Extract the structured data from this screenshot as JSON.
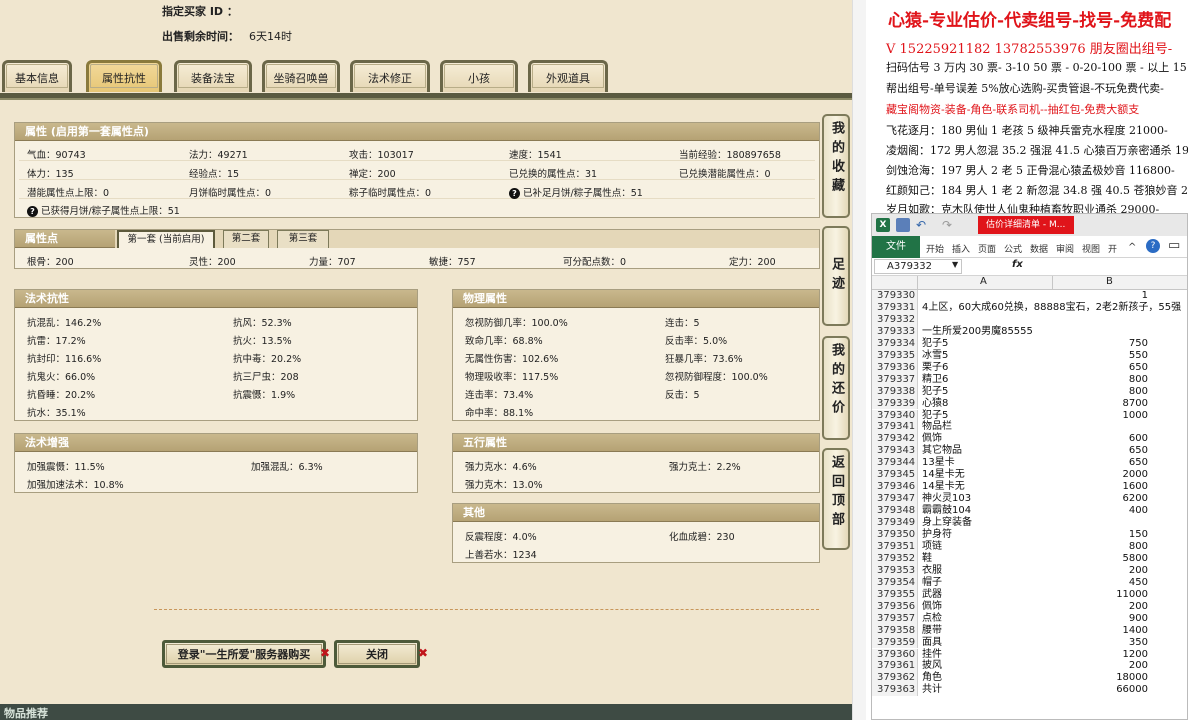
{
  "header": {
    "buyer_label": "指定买家 ID ：",
    "buyer_value": "",
    "time_label": "出售剩余时间：",
    "time_value": "6天14时"
  },
  "tabs": [
    "基本信息",
    "属性抗性",
    "装备法宝",
    "坐骑召唤兽",
    "法术修正",
    "小孩",
    "外观道具"
  ],
  "active_tab": "属性抗性",
  "attr_panel": {
    "title": "属性 (启用第一套属性点)",
    "rows": [
      [
        "气血：90743",
        "法力：49271",
        "攻击：103017",
        "速度：1541",
        "当前经验：180897658"
      ],
      [
        "体力：135",
        "经验点：15",
        "禅定：200",
        "已兑换的属性点：31",
        "已兑换潜能属性点：0"
      ],
      [
        "潜能属性点上限：0",
        "月饼临时属性点：0",
        "粽子临时属性点：0",
        "已补足月饼/粽子属性点：51",
        ""
      ],
      [
        "已获得月饼/粽子属性点上限：51",
        "",
        "",
        "",
        ""
      ]
    ]
  },
  "points_panel": {
    "title": "属性点",
    "subtabs": [
      "第一套 (当前启用)",
      "第二套",
      "第三套"
    ],
    "values": [
      "根骨：200",
      "灵性：200",
      "力量：707",
      "敏捷：757",
      "可分配点数：0",
      "定力：200"
    ]
  },
  "spell_resist": {
    "title": "法术抗性",
    "rows": [
      [
        "抗混乱：146.2%",
        "抗风：52.3%"
      ],
      [
        "抗雷：17.2%",
        "抗火：13.5%"
      ],
      [
        "抗封印：116.6%",
        "抗中毒：20.2%"
      ],
      [
        "抗鬼火：66.0%",
        "抗三尸虫：208"
      ],
      [
        "抗昏睡：20.2%",
        "抗震慑：1.9%"
      ],
      [
        "抗水：35.1%",
        ""
      ]
    ]
  },
  "physical": {
    "title": "物理属性",
    "rows": [
      [
        "忽视防御几率：100.0%",
        "连击：5"
      ],
      [
        "致命几率：68.8%",
        "反击率：5.0%"
      ],
      [
        "无属性伤害：102.6%",
        "狂暴几率：73.6%"
      ],
      [
        "物理吸收率：117.5%",
        "忽视防御程度：100.0%"
      ],
      [
        "连击率：73.4%",
        "反击：5"
      ],
      [
        "命中率：88.1%",
        ""
      ]
    ]
  },
  "spell_boost": {
    "title": "法术增强",
    "rows": [
      [
        "加强震慑：11.5%",
        "加强混乱：6.3%"
      ],
      [
        "加强加速法术：10.8%",
        ""
      ]
    ]
  },
  "five_elements": {
    "title": "五行属性",
    "rows": [
      [
        "强力克水：4.6%",
        "强力克土：2.2%"
      ],
      [
        "强力克木：13.0%",
        ""
      ]
    ]
  },
  "other": {
    "title": "其他",
    "rows": [
      [
        "反震程度：4.0%",
        "化血成碧：230"
      ],
      [
        "上善若水：1234",
        ""
      ]
    ]
  },
  "side_buttons": [
    "我的收藏",
    "足迹",
    "我的还价",
    "返回顶部"
  ],
  "buttons": {
    "login": "登录\"一生所爱\"服务器购买",
    "close": "关闭"
  },
  "footer": "物品推荐",
  "ad": {
    "title": "心猿-专业估价-代卖组号-找号-免费配",
    "phone": "V 15225921182    13782553976 朋友圈出组号-",
    "lines": [
      "扫码估号 3 万内 30 票- 3-10 50 票 - 0-20-100 票 - 以上 15",
      "帮出组号-单号误差 5%放心选购-买贵管退-不玩免费代卖-",
      "藏宝阁物资-装备-角色-联系司机--抽红包-免费大额支",
      "飞花逐月：180 男仙 1 老孩 5 级神兵雷克水程度 21000-",
      "凌烟阁：172 男人忽混 35.2 强混 41.5 心猿百万亲密通杀 193",
      "剑蚀沧海：197 男人 2 老 5 正骨混心猿孟极妙音 116800-",
      "红颜知己：184 男人 1 老 2 新忽混 34.8 强 40.5 苍狼妙音 229",
      "岁月如歌：克木队使世人仙鬼种植畜牧职业通杀 29000-"
    ]
  },
  "excel": {
    "doc_title": "估价详细清单 - M...",
    "ribbon_file": "文件",
    "ribbon_tabs": [
      "开始",
      "插入",
      "页面",
      "公式",
      "数据",
      "审阅",
      "视图",
      "开"
    ],
    "name_box": "A379332",
    "fx": "fx",
    "col_a": "A",
    "col_b": "B",
    "rows": [
      [
        "379330",
        "",
        "1"
      ],
      [
        "379331",
        "4上区，60大成60兑换，88888宝石，2老2新孩子，55强",
        ""
      ],
      [
        "379332",
        "",
        ""
      ],
      [
        "379333",
        "一生所爱200男魔85555",
        ""
      ],
      [
        "379334",
        "犯子5",
        "750"
      ],
      [
        "379335",
        "冰雪5",
        "550"
      ],
      [
        "379336",
        "栗子6",
        "650"
      ],
      [
        "379337",
        "精卫6",
        "800"
      ],
      [
        "379338",
        "犯子5",
        "800"
      ],
      [
        "379339",
        "心猿8",
        "8700"
      ],
      [
        "379340",
        "犯子5",
        "1000"
      ],
      [
        "379341",
        "物品栏",
        ""
      ],
      [
        "379342",
        "佩饰",
        "600"
      ],
      [
        "379343",
        "其它物品",
        "650"
      ],
      [
        "379344",
        "13星卡",
        "650"
      ],
      [
        "379345",
        "14星卡无",
        "2000"
      ],
      [
        "379346",
        "14星卡无",
        "1600"
      ],
      [
        "379347",
        "神火灵103",
        "6200"
      ],
      [
        "379348",
        "霸霸鼓104",
        "400"
      ],
      [
        "379349",
        "身上穿装备",
        ""
      ],
      [
        "379350",
        "护身符",
        "150"
      ],
      [
        "379351",
        "项链",
        "800"
      ],
      [
        "379352",
        "鞋",
        "5800"
      ],
      [
        "379353",
        "衣服",
        "200"
      ],
      [
        "379354",
        "帽子",
        "450"
      ],
      [
        "379355",
        "武器",
        "11000"
      ],
      [
        "379356",
        "佩饰",
        "200"
      ],
      [
        "379357",
        "点检",
        "900"
      ],
      [
        "379358",
        "腰带",
        "1400"
      ],
      [
        "379359",
        "面具",
        "350"
      ],
      [
        "379360",
        "挂件",
        "1200"
      ],
      [
        "379361",
        "披风",
        "200"
      ],
      [
        "379362",
        "角色",
        "18000"
      ],
      [
        "379363",
        "共计",
        "66000"
      ]
    ]
  }
}
